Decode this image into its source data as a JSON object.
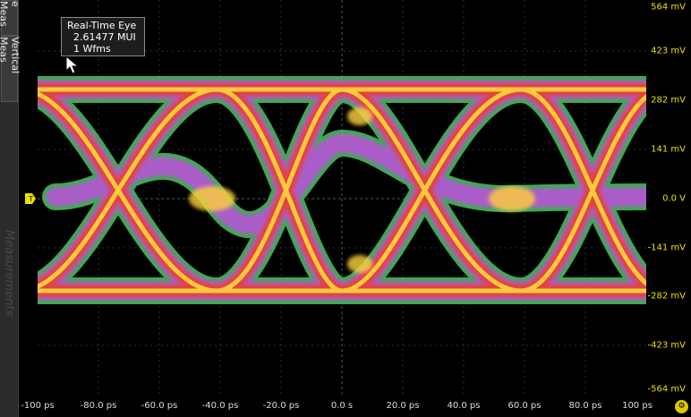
{
  "side_tabs": {
    "tab1": "e Meas",
    "tab2": "Vertical Meas",
    "watermark": "Measurements"
  },
  "tooltip": {
    "title": "Real-Time Eye",
    "value": "2.61477 MUI",
    "count": "1 Wfms"
  },
  "y_axis": {
    "labels": [
      "564 mV",
      "423 mV",
      "282 mV",
      "141 mV",
      "0.0 V",
      "-141 mV",
      "-282 mV",
      "-423 mV",
      "-564 mV"
    ]
  },
  "x_axis": {
    "labels": [
      "-100 ps",
      "-80.0 ps",
      "-60.0 ps",
      "-40.0 ps",
      "-20.0 ps",
      "0.0 s",
      "20.0 ps",
      "40.0 ps",
      "60.0 ps",
      "80.0 ps",
      "100 ps"
    ]
  },
  "trigger_marker": {
    "label": "T",
    "color": "#e8e000"
  },
  "colors": {
    "axis_label": "#e8e000",
    "eye_hot": "#ffd23a",
    "eye_mid": "#e8403a",
    "eye_cool": "#c050e0",
    "eye_edge": "#36c84a"
  },
  "icons": {
    "cursor": "arrow-cursor-icon",
    "corner": "settings-gear-icon"
  }
}
